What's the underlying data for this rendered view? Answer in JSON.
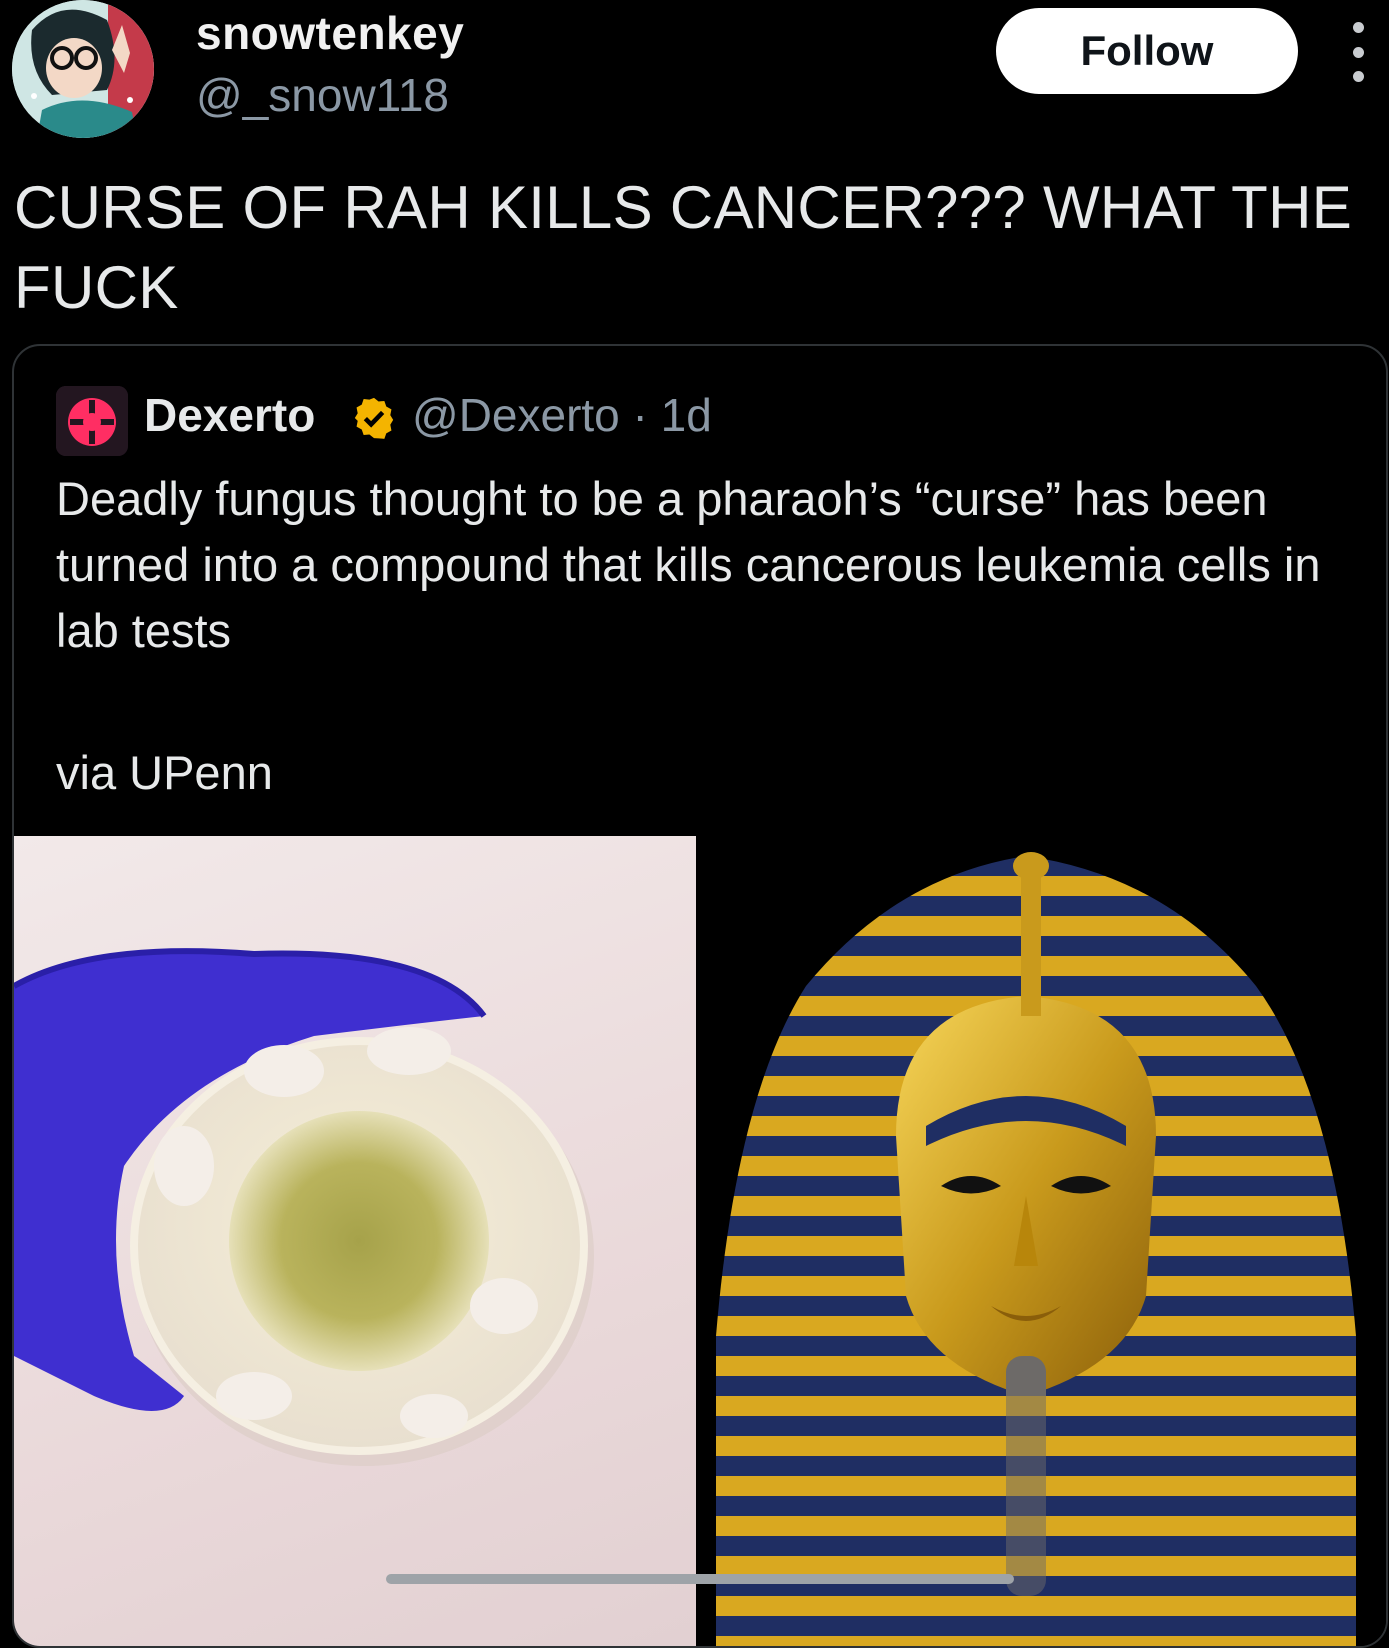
{
  "author": {
    "display_name": "snowtenkey",
    "handle": "@_snow118",
    "avatar_icon": "anime-avatar"
  },
  "follow_button": {
    "label": "Follow"
  },
  "more_menu": {
    "icon": "more-vertical-icon"
  },
  "post": {
    "text": "CURSE OF RAH KILLS CANCER??? WHAT THE FUCK"
  },
  "quoted_post": {
    "avatar_icon": "dexerto-logo",
    "display_name": "Dexerto",
    "verified_icon": "verified-badge-icon",
    "verified_color": "#f4b400",
    "handle_time": "@Dexerto · 1d",
    "text": "Deadly fungus thought to be a pharaoh’s “curse” has been turned into a compound that kills cancerous leukemia cells in lab tests",
    "via": "via UPenn",
    "media": [
      {
        "name": "petri-dish-photo",
        "description_icon": "petri-dish-image"
      },
      {
        "name": "pharaoh-mask-photo",
        "description_icon": "pharaoh-mask-image"
      }
    ]
  }
}
